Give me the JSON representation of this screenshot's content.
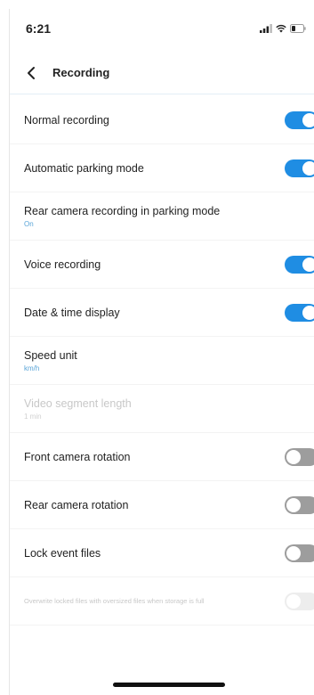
{
  "status_bar": {
    "time": "6:21"
  },
  "header": {
    "title": "Recording"
  },
  "settings": [
    {
      "label": "Normal recording",
      "sub": "",
      "toggle": "on"
    },
    {
      "label": "Automatic parking mode",
      "sub": "",
      "toggle": "on"
    },
    {
      "label": "Rear camera recording in parking mode",
      "sub": "On",
      "toggle": "none"
    },
    {
      "label": "Voice recording",
      "sub": "",
      "toggle": "on"
    },
    {
      "label": "Date & time display",
      "sub": "",
      "toggle": "on"
    },
    {
      "label": "Speed unit",
      "sub": "km/h",
      "toggle": "none"
    },
    {
      "label": "Video segment length",
      "sub": "1 min",
      "toggle": "none",
      "disabled": true
    },
    {
      "label": "Front camera rotation",
      "sub": "",
      "toggle": "off"
    },
    {
      "label": "Rear camera rotation",
      "sub": "",
      "toggle": "off"
    },
    {
      "label": "Lock event files",
      "sub": "",
      "toggle": "off"
    },
    {
      "label": "Overwrite locked files with oversized files when storage is full",
      "sub": "",
      "toggle": "faint",
      "disabled": true,
      "small": true
    }
  ],
  "colors": {
    "accent": "#1f8de3",
    "toggle_off": "#9d9d9d",
    "sub_text": "#5aa5d8"
  },
  "icons": {
    "back": "chevron-left-icon",
    "signal": "signal-icon",
    "wifi": "wifi-icon",
    "battery": "battery-icon"
  }
}
